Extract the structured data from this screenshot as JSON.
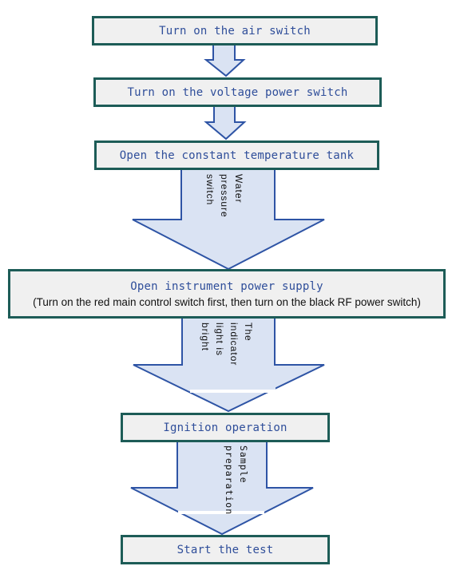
{
  "diagram": {
    "type": "flowchart",
    "direction": "top-to-bottom",
    "colors": {
      "box_fill": "#f0f0f0",
      "box_border": "#1d5c57",
      "box_text": "#2f4e9a",
      "arrow_fill": "#dae3f3",
      "arrow_stroke": "#2e54a5"
    },
    "steps": [
      {
        "label": "Turn on the air switch"
      },
      {
        "label": "Turn on the voltage power switch"
      },
      {
        "label": "Open the constant temperature tank"
      },
      {
        "label": "Open instrument power supply",
        "note": "(Turn on the red main control switch first, then turn on the black RF power switch)"
      },
      {
        "label": "Ignition operation"
      },
      {
        "label": "Start the test"
      }
    ],
    "transitions": [
      {
        "from": 0,
        "to": 1,
        "label": ""
      },
      {
        "from": 1,
        "to": 2,
        "label": ""
      },
      {
        "from": 2,
        "to": 3,
        "label": "Water pressure switch",
        "lines": [
          "Water",
          "pressure",
          "switch"
        ]
      },
      {
        "from": 3,
        "to": 4,
        "label": "The indicator light is bright",
        "lines": [
          "The",
          "indicator",
          "light is",
          "bright"
        ]
      },
      {
        "from": 4,
        "to": 5,
        "label": "Sample preparation",
        "lines": [
          "Sample",
          "preparation"
        ]
      }
    ]
  }
}
